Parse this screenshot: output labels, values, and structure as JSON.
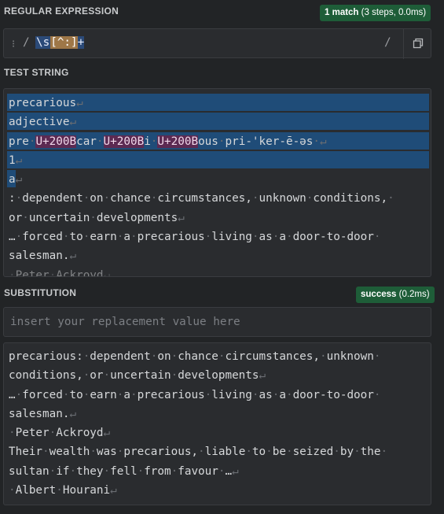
{
  "regex": {
    "section_label": "REGULAR EXPRESSION",
    "match_badge": {
      "bold": "1 match",
      "detail": "(3 steps, 0.0ms)"
    },
    "delimiter_open": "/",
    "pattern_tokens": [
      "\\s",
      "[^:]",
      "+"
    ],
    "delimiter_close": "/"
  },
  "test_string": {
    "section_label": "TEST STRING",
    "lines": [
      {
        "segments": [
          [
            "t",
            "precarious"
          ],
          [
            "w",
            "↵"
          ]
        ],
        "highlight": true
      },
      {
        "segments": [
          [
            "t",
            "adjective"
          ],
          [
            "w",
            "↵"
          ]
        ],
        "highlight": true
      },
      {
        "segments": [
          [
            "t",
            "pre"
          ],
          [
            "w",
            "·"
          ],
          [
            "u",
            "U+200B"
          ],
          [
            "t",
            "car"
          ],
          [
            "w",
            "·"
          ],
          [
            "u",
            "U+200B"
          ],
          [
            "t",
            "i"
          ],
          [
            "w",
            "·"
          ],
          [
            "u",
            "U+200B"
          ],
          [
            "t",
            "ous"
          ],
          [
            "w",
            "·"
          ],
          [
            "t",
            "pri-'ker-ē-əs"
          ],
          [
            "w",
            "·↵"
          ]
        ],
        "highlight": true
      },
      {
        "segments": [
          [
            "t",
            "1"
          ],
          [
            "w",
            "↵"
          ]
        ],
        "highlight": true
      },
      {
        "segments": [
          [
            "t",
            "a"
          ],
          [
            "w",
            "↵"
          ]
        ],
        "highlight": false,
        "partial": true
      },
      {
        "segments": [
          [
            "t",
            ":"
          ],
          [
            "w",
            "·"
          ],
          [
            "t",
            "dependent"
          ],
          [
            "w",
            "·"
          ],
          [
            "t",
            "on"
          ],
          [
            "w",
            "·"
          ],
          [
            "t",
            "chance"
          ],
          [
            "w",
            "·"
          ],
          [
            "t",
            "circumstances,"
          ],
          [
            "w",
            "·"
          ],
          [
            "t",
            "unknown"
          ],
          [
            "w",
            "·"
          ],
          [
            "t",
            "conditions,"
          ],
          [
            "w",
            "·"
          ]
        ],
        "highlight": false
      },
      {
        "segments": [
          [
            "t",
            "or"
          ],
          [
            "w",
            "·"
          ],
          [
            "t",
            "uncertain"
          ],
          [
            "w",
            "·"
          ],
          [
            "t",
            "developments"
          ],
          [
            "w",
            "↵"
          ]
        ],
        "highlight": false
      },
      {
        "segments": [
          [
            "t",
            "…"
          ],
          [
            "w",
            "·"
          ],
          [
            "t",
            "forced"
          ],
          [
            "w",
            "·"
          ],
          [
            "t",
            "to"
          ],
          [
            "w",
            "·"
          ],
          [
            "t",
            "earn"
          ],
          [
            "w",
            "·"
          ],
          [
            "t",
            "a"
          ],
          [
            "w",
            "·"
          ],
          [
            "t",
            "precarious"
          ],
          [
            "w",
            "·"
          ],
          [
            "t",
            "living"
          ],
          [
            "w",
            "·"
          ],
          [
            "t",
            "as"
          ],
          [
            "w",
            "·"
          ],
          [
            "t",
            "a"
          ],
          [
            "w",
            "·"
          ],
          [
            "t",
            "door-to-door"
          ],
          [
            "w",
            "·"
          ]
        ],
        "highlight": false
      },
      {
        "segments": [
          [
            "t",
            "salesman."
          ],
          [
            "w",
            "↵"
          ]
        ],
        "highlight": false
      },
      {
        "segments": [
          [
            "w",
            "·"
          ],
          [
            "t",
            "Peter"
          ],
          [
            "w",
            "·"
          ],
          [
            "t",
            "Ackroyd"
          ],
          [
            "w",
            "↵"
          ]
        ],
        "highlight": false,
        "faded": true
      }
    ]
  },
  "substitution": {
    "section_label": "SUBSTITUTION",
    "status_badge": {
      "bold": "success",
      "detail": "(0.2ms)"
    },
    "placeholder": "insert your replacement value here",
    "result_lines": [
      [
        [
          "t",
          "precarious:"
        ],
        [
          "w",
          "·"
        ],
        [
          "t",
          "dependent"
        ],
        [
          "w",
          "·"
        ],
        [
          "t",
          "on"
        ],
        [
          "w",
          "·"
        ],
        [
          "t",
          "chance"
        ],
        [
          "w",
          "·"
        ],
        [
          "t",
          "circumstances,"
        ],
        [
          "w",
          "·"
        ],
        [
          "t",
          "unknown"
        ],
        [
          "w",
          "·"
        ]
      ],
      [
        [
          "t",
          "conditions,"
        ],
        [
          "w",
          "·"
        ],
        [
          "t",
          "or"
        ],
        [
          "w",
          "·"
        ],
        [
          "t",
          "uncertain"
        ],
        [
          "w",
          "·"
        ],
        [
          "t",
          "developments"
        ],
        [
          "w",
          "↵"
        ]
      ],
      [
        [
          "t",
          "…"
        ],
        [
          "w",
          "·"
        ],
        [
          "t",
          "forced"
        ],
        [
          "w",
          "·"
        ],
        [
          "t",
          "to"
        ],
        [
          "w",
          "·"
        ],
        [
          "t",
          "earn"
        ],
        [
          "w",
          "·"
        ],
        [
          "t",
          "a"
        ],
        [
          "w",
          "·"
        ],
        [
          "t",
          "precarious"
        ],
        [
          "w",
          "·"
        ],
        [
          "t",
          "living"
        ],
        [
          "w",
          "·"
        ],
        [
          "t",
          "as"
        ],
        [
          "w",
          "·"
        ],
        [
          "t",
          "a"
        ],
        [
          "w",
          "·"
        ],
        [
          "t",
          "door-to-door"
        ],
        [
          "w",
          "·"
        ]
      ],
      [
        [
          "t",
          "salesman."
        ],
        [
          "w",
          "↵"
        ]
      ],
      [
        [
          "w",
          "·"
        ],
        [
          "t",
          "Peter"
        ],
        [
          "w",
          "·"
        ],
        [
          "t",
          "Ackroyd"
        ],
        [
          "w",
          "↵"
        ]
      ],
      [
        [
          "t",
          "Their"
        ],
        [
          "w",
          "·"
        ],
        [
          "t",
          "wealth"
        ],
        [
          "w",
          "·"
        ],
        [
          "t",
          "was"
        ],
        [
          "w",
          "·"
        ],
        [
          "t",
          "precarious,"
        ],
        [
          "w",
          "·"
        ],
        [
          "t",
          "liable"
        ],
        [
          "w",
          "·"
        ],
        [
          "t",
          "to"
        ],
        [
          "w",
          "·"
        ],
        [
          "t",
          "be"
        ],
        [
          "w",
          "·"
        ],
        [
          "t",
          "seized"
        ],
        [
          "w",
          "·"
        ],
        [
          "t",
          "by"
        ],
        [
          "w",
          "·"
        ],
        [
          "t",
          "the"
        ],
        [
          "w",
          "·"
        ]
      ],
      [
        [
          "t",
          "sultan"
        ],
        [
          "w",
          "·"
        ],
        [
          "t",
          "if"
        ],
        [
          "w",
          "·"
        ],
        [
          "t",
          "they"
        ],
        [
          "w",
          "·"
        ],
        [
          "t",
          "fell"
        ],
        [
          "w",
          "·"
        ],
        [
          "t",
          "from"
        ],
        [
          "w",
          "·"
        ],
        [
          "t",
          "favour"
        ],
        [
          "w",
          "·"
        ],
        [
          "t",
          "…"
        ],
        [
          "w",
          "↵"
        ]
      ],
      [
        [
          "w",
          "·"
        ],
        [
          "t",
          "Albert"
        ],
        [
          "w",
          "·"
        ],
        [
          "t",
          "Hourani"
        ],
        [
          "w",
          "↵"
        ]
      ]
    ]
  },
  "colors": {
    "background": "#222426",
    "panel": "#2a2c2f",
    "match_highlight": "#1f4c78",
    "unicode_token": "#5c2a52",
    "badge_green": "#1e5d38",
    "char_class": "#9e7748"
  },
  "icons": {
    "drag_handle": "drag-handle-icon",
    "copy": "copy-icon"
  }
}
